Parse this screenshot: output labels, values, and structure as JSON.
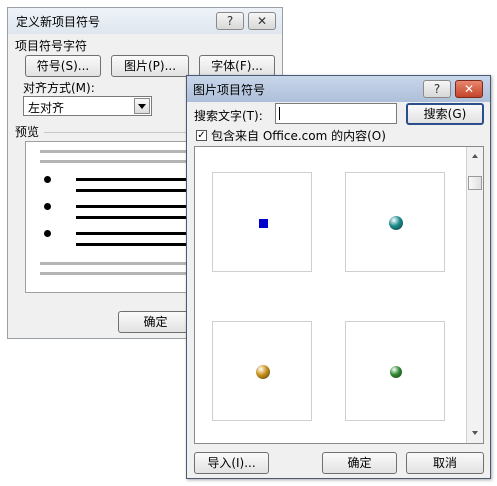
{
  "define_dialog": {
    "title": "定义新项目符号",
    "help_label": "?",
    "close_label": "✕",
    "group_label": "项目符号字符",
    "symbol_button": "符号(S)...",
    "picture_button": "图片(P)...",
    "font_button": "字体(F)...",
    "alignment_label": "对齐方式(M):",
    "alignment_value": "左对齐",
    "preview_label": "预览",
    "ok_button": "确定"
  },
  "picture_dialog": {
    "title": "图片项目符号",
    "help_label": "?",
    "close_label": "✕",
    "search_label": "搜索文字(T):",
    "search_value": "",
    "search_button": "搜索(G)",
    "include_office_label": "包含来自 Office.com 的内容(O)",
    "include_office_checked": true,
    "bullets": [
      {
        "color": "#0000cc",
        "shape": "square"
      },
      {
        "color": "#1a8a8a",
        "shape": "sphere"
      },
      {
        "color": "#c8901a",
        "shape": "sphere"
      },
      {
        "color": "#2f8a2f",
        "shape": "sphere"
      }
    ],
    "import_button": "导入(I)...",
    "ok_button": "确定",
    "cancel_button": "取消"
  }
}
